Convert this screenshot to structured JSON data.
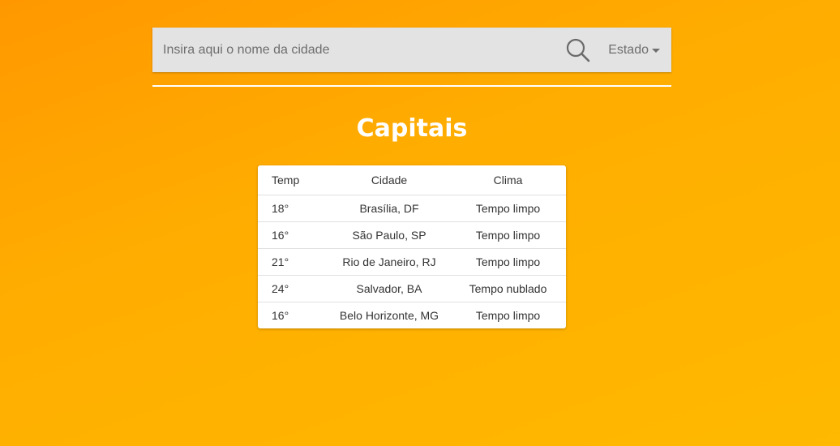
{
  "search": {
    "placeholder": "Insira aqui o nome da cidade",
    "value": "",
    "state_dropdown_label": "Estado"
  },
  "page": {
    "title": "Capitais"
  },
  "table": {
    "headers": {
      "temp": "Temp",
      "city": "Cidade",
      "weather": "Clima"
    },
    "rows": [
      {
        "temp": "18°",
        "city": "Brasília, DF",
        "weather": "Tempo limpo"
      },
      {
        "temp": "16°",
        "city": "São Paulo, SP",
        "weather": "Tempo limpo"
      },
      {
        "temp": "21°",
        "city": "Rio de Janeiro, RJ",
        "weather": "Tempo limpo"
      },
      {
        "temp": "24°",
        "city": "Salvador, BA",
        "weather": "Tempo nublado"
      },
      {
        "temp": "16°",
        "city": "Belo Horizonte, MG",
        "weather": "Tempo limpo"
      }
    ]
  },
  "colors": {
    "background_start": "#ff9800",
    "background_end": "#ffb900",
    "search_bar": "#e3e3e3",
    "title": "#ffffff"
  },
  "icons": {
    "search": "search-icon",
    "dropdown": "chevron-down-icon"
  }
}
